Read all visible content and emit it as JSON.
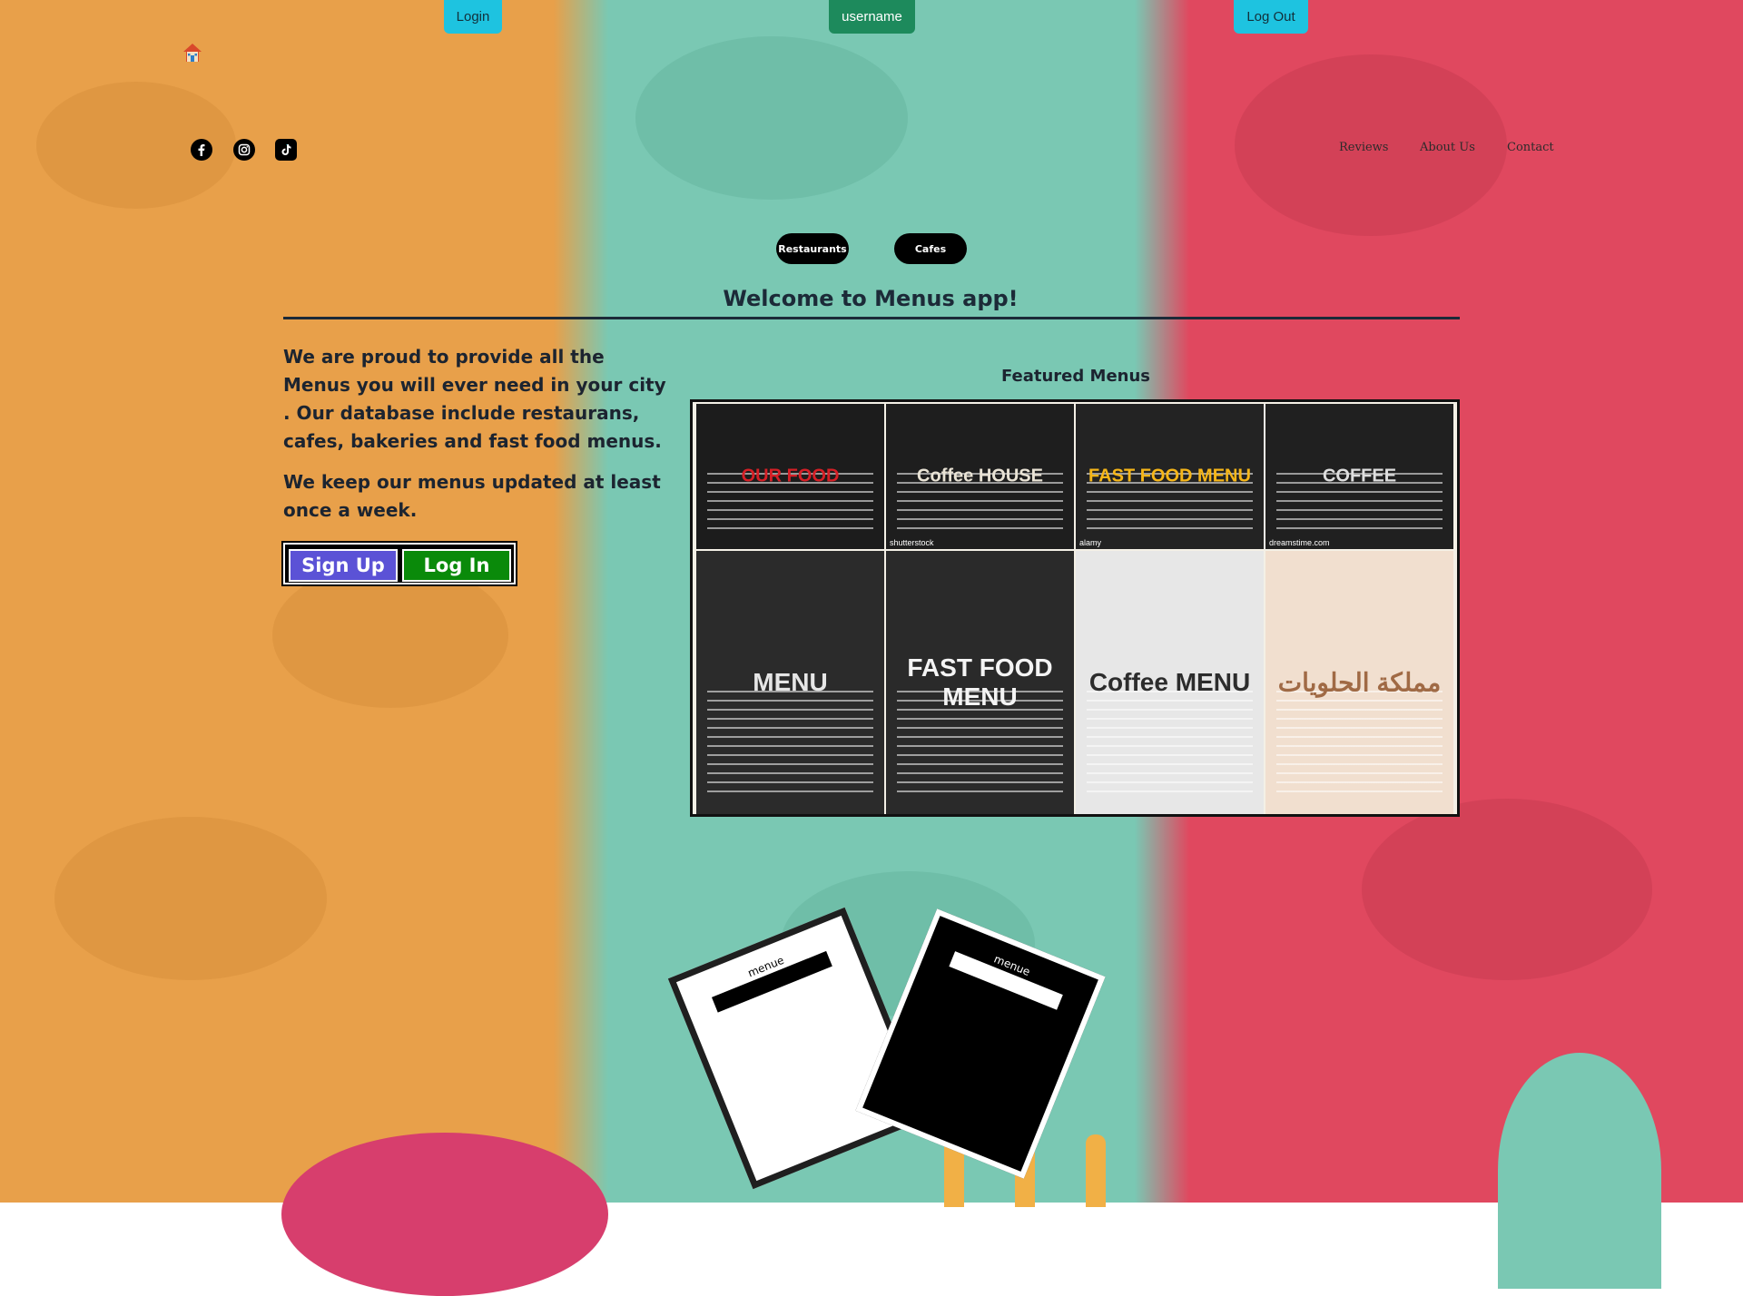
{
  "topbar": {
    "login_label": "Login",
    "username_label": "username",
    "logout_label": "Log Out"
  },
  "icons": {
    "home": "home-icon",
    "facebook": "facebook-icon",
    "instagram": "instagram-icon",
    "tiktok": "tiktok-icon"
  },
  "nav": {
    "items": [
      {
        "label": "Reviews"
      },
      {
        "label": "About Us"
      },
      {
        "label": "Contact"
      }
    ]
  },
  "categories": [
    {
      "label": "Restaurants"
    },
    {
      "label": "Cafes"
    }
  ],
  "main": {
    "title": "Welcome to Menus app!",
    "intro_1": "We are proud to provide all the Menus you will ever need in your city . Our database include restaurans, cafes, bakeries and fast food menus.",
    "intro_2": "We keep our menus updated at least once a week.",
    "signup_label": "Sign Up",
    "login_label": "Log In"
  },
  "featured": {
    "heading": "Featured Menus",
    "tiles": [
      {
        "name": "OUR FOOD",
        "bg": "#1c1c1c",
        "accent": "#d61f26",
        "credit": ""
      },
      {
        "name": "Coffee HOUSE",
        "bg": "#1e1e1e",
        "accent": "#e9e3d5",
        "credit": "shutterstock"
      },
      {
        "name": "FAST FOOD MENU",
        "bg": "#232323",
        "accent": "#f6b618",
        "credit": "alamy"
      },
      {
        "name": "COFFEE",
        "bg": "#202020",
        "accent": "#dedede",
        "credit": "dreamstime.com"
      },
      {
        "name": "MENU",
        "bg": "#2b2b2b",
        "accent": "#e6e6e6",
        "credit": ""
      },
      {
        "name": "FAST FOOD MENU",
        "bg": "#2a2a2a",
        "accent": "#f4f4f4",
        "credit": ""
      },
      {
        "name": "Coffee MENU",
        "bg": "#e7e7e7",
        "accent": "#2c2c2c",
        "credit": ""
      },
      {
        "name": "مملكة الحلويات",
        "bg": "#f1dfcf",
        "accent": "#a06a45",
        "credit": ""
      }
    ]
  },
  "decor": {
    "paper_label": "menue",
    "colors": {
      "orange": "#e8a04a",
      "teal": "#7ac8b3",
      "red": "#e0485f"
    }
  }
}
